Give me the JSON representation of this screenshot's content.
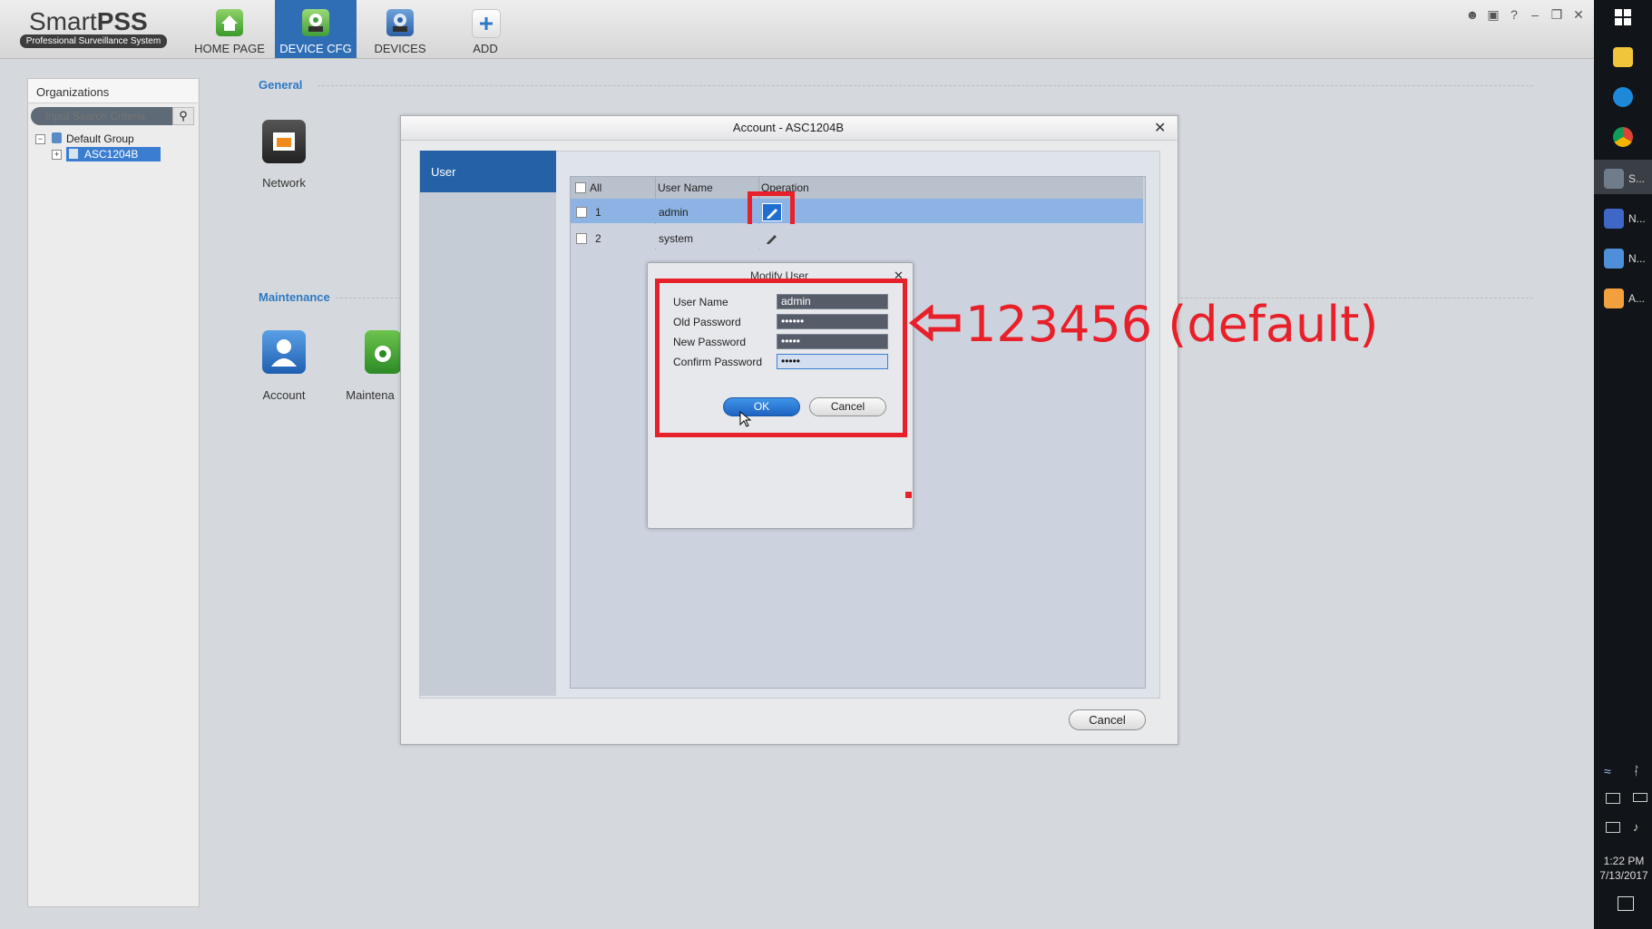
{
  "app": {
    "brand_light": "Smart",
    "brand_bold": "PSS",
    "tagline": "Professional Surveillance System"
  },
  "nav": [
    {
      "label": "HOME PAGE",
      "icon": "home-icon"
    },
    {
      "label": "DEVICE CFG",
      "icon": "device-cfg-icon",
      "active": true
    },
    {
      "label": "DEVICES",
      "icon": "devices-icon"
    },
    {
      "label": "ADD",
      "icon": "add-icon"
    }
  ],
  "window_controls": [
    "user-icon",
    "lock-icon",
    "help-icon",
    "minimize-icon",
    "restore-icon",
    "close-icon"
  ],
  "organizations": {
    "title": "Organizations",
    "search_placeholder": "Input Search Criteria",
    "tree": {
      "group": "Default Group",
      "device": "ASC1204B"
    }
  },
  "config": {
    "general_label": "General",
    "maintenance_label": "Maintenance",
    "network_label": "Network",
    "account_label": "Account",
    "maintenance_item_label": "Maintena"
  },
  "account_dialog": {
    "title": "Account - ASC1204B",
    "tab_user": "User",
    "columns": {
      "all": "All",
      "user_name": "User Name",
      "operation": "Operation"
    },
    "users": [
      {
        "id": "1",
        "name": "admin"
      },
      {
        "id": "2",
        "name": "system"
      }
    ],
    "cancel": "Cancel"
  },
  "modify_user": {
    "title": "Modify User",
    "labels": {
      "user_name": "User Name",
      "old_password": "Old Password",
      "new_password": "New Password",
      "confirm_password": "Confirm Password"
    },
    "values": {
      "user_name": "admin",
      "old_password": "••••••",
      "new_password": "•••••",
      "confirm_password": "•••••"
    },
    "ok": "OK",
    "cancel": "Cancel"
  },
  "annotation": {
    "text": "123456 (default)",
    "color": "#e8202a"
  },
  "taskbar": {
    "apps": [
      {
        "icon": "file-explorer-icon",
        "label": ""
      },
      {
        "icon": "internet-explorer-icon",
        "label": ""
      },
      {
        "icon": "chrome-icon",
        "label": ""
      },
      {
        "icon": "smartpss-icon",
        "label": "S..."
      },
      {
        "icon": "network-app-icon",
        "label": "N..."
      },
      {
        "icon": "network-app-2-icon",
        "label": "N..."
      },
      {
        "icon": "app-a-icon",
        "label": "A..."
      }
    ],
    "time": "1:22 PM",
    "date": "7/13/2017"
  },
  "colors": {
    "accent": "#2f6db5",
    "tab_active": "#2461a6",
    "selected_row": "#8cb3e3"
  }
}
